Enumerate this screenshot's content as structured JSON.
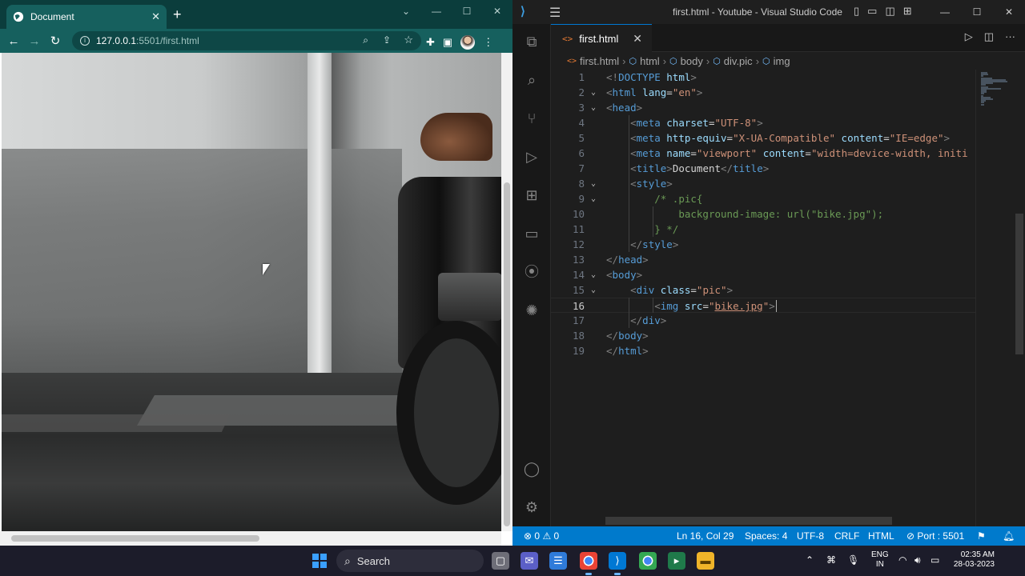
{
  "browser": {
    "tab_title": "Document",
    "url_host": "127.0.0.1",
    "url_rest": ":5501/first.html",
    "image_alt": "bike.jpg",
    "icons": [
      "globe-icon",
      "close-icon",
      "plus-icon",
      "back-icon",
      "forward-icon",
      "reload-icon",
      "info-icon",
      "zoom-icon",
      "share-icon",
      "star-icon",
      "extensions-icon",
      "sidepanel-icon",
      "profile-avatar",
      "kebab-menu-icon"
    ]
  },
  "vscode": {
    "window_title": "first.html - Youtube - Visual Studio Code",
    "tab_label": "first.html",
    "breadcrumbs": [
      "first.html",
      "html",
      "body",
      "div.pic",
      "img"
    ],
    "lines": [
      {
        "n": "1",
        "segs": [
          [
            "p",
            "<!"
          ],
          [
            "t",
            "DOCTYPE"
          ],
          [
            "w",
            " "
          ],
          [
            "a",
            "html"
          ],
          [
            "p",
            ">"
          ]
        ]
      },
      {
        "n": "2",
        "segs": [
          [
            "p",
            "<"
          ],
          [
            "t",
            "html"
          ],
          [
            "w",
            " "
          ],
          [
            "a",
            "lang"
          ],
          [
            "w",
            "="
          ],
          [
            "s",
            "\"en\""
          ],
          [
            "p",
            ">"
          ]
        ]
      },
      {
        "n": "3",
        "segs": [
          [
            "p",
            "<"
          ],
          [
            "t",
            "head"
          ],
          [
            "p",
            ">"
          ]
        ]
      },
      {
        "n": "4",
        "segs": [
          [
            "w",
            "    "
          ],
          [
            "p",
            "<"
          ],
          [
            "t",
            "meta"
          ],
          [
            "w",
            " "
          ],
          [
            "a",
            "charset"
          ],
          [
            "w",
            "="
          ],
          [
            "s",
            "\"UTF-8\""
          ],
          [
            "p",
            ">"
          ]
        ]
      },
      {
        "n": "5",
        "segs": [
          [
            "w",
            "    "
          ],
          [
            "p",
            "<"
          ],
          [
            "t",
            "meta"
          ],
          [
            "w",
            " "
          ],
          [
            "a",
            "http-equiv"
          ],
          [
            "w",
            "="
          ],
          [
            "s",
            "\"X-UA-Compatible\""
          ],
          [
            "w",
            " "
          ],
          [
            "a",
            "content"
          ],
          [
            "w",
            "="
          ],
          [
            "s",
            "\"IE=edge\""
          ],
          [
            "p",
            ">"
          ]
        ]
      },
      {
        "n": "6",
        "segs": [
          [
            "w",
            "    "
          ],
          [
            "p",
            "<"
          ],
          [
            "t",
            "meta"
          ],
          [
            "w",
            " "
          ],
          [
            "a",
            "name"
          ],
          [
            "w",
            "="
          ],
          [
            "s",
            "\"viewport\""
          ],
          [
            "w",
            " "
          ],
          [
            "a",
            "content"
          ],
          [
            "w",
            "="
          ],
          [
            "s",
            "\"width=device-width, initi"
          ]
        ]
      },
      {
        "n": "7",
        "segs": [
          [
            "w",
            "    "
          ],
          [
            "p",
            "<"
          ],
          [
            "t",
            "title"
          ],
          [
            "p",
            ">"
          ],
          [
            "w",
            "Document"
          ],
          [
            "p",
            "</"
          ],
          [
            "t",
            "title"
          ],
          [
            "p",
            ">"
          ]
        ]
      },
      {
        "n": "8",
        "segs": [
          [
            "w",
            "    "
          ],
          [
            "p",
            "<"
          ],
          [
            "t",
            "style"
          ],
          [
            "p",
            ">"
          ]
        ]
      },
      {
        "n": "9",
        "segs": [
          [
            "w",
            "        "
          ],
          [
            "c",
            "/* .pic{"
          ]
        ]
      },
      {
        "n": "10",
        "segs": [
          [
            "w",
            "            "
          ],
          [
            "c",
            "background-image: url(\"bike.jpg\");"
          ]
        ]
      },
      {
        "n": "11",
        "segs": [
          [
            "w",
            "        "
          ],
          [
            "c",
            "} */"
          ]
        ]
      },
      {
        "n": "12",
        "segs": [
          [
            "w",
            "    "
          ],
          [
            "p",
            "</"
          ],
          [
            "t",
            "style"
          ],
          [
            "p",
            ">"
          ]
        ]
      },
      {
        "n": "13",
        "segs": [
          [
            "p",
            "</"
          ],
          [
            "t",
            "head"
          ],
          [
            "p",
            ">"
          ]
        ]
      },
      {
        "n": "14",
        "segs": [
          [
            "p",
            "<"
          ],
          [
            "t",
            "body"
          ],
          [
            "p",
            ">"
          ]
        ]
      },
      {
        "n": "15",
        "segs": [
          [
            "w",
            "    "
          ],
          [
            "p",
            "<"
          ],
          [
            "t",
            "div"
          ],
          [
            "w",
            " "
          ],
          [
            "a",
            "class"
          ],
          [
            "w",
            "="
          ],
          [
            "s",
            "\"pic\""
          ],
          [
            "p",
            ">"
          ]
        ]
      },
      {
        "n": "16",
        "segs": [
          [
            "w",
            "        "
          ],
          [
            "p",
            "<"
          ],
          [
            "t",
            "img"
          ],
          [
            "w",
            " "
          ],
          [
            "a",
            "src"
          ],
          [
            "w",
            "="
          ],
          [
            "s",
            "\""
          ],
          [
            "s",
            "bike.jpg"
          ],
          [
            "s",
            "\""
          ],
          [
            "p",
            ">"
          ]
        ]
      },
      {
        "n": "17",
        "segs": [
          [
            "w",
            "    "
          ],
          [
            "p",
            "</"
          ],
          [
            "t",
            "div"
          ],
          [
            "p",
            ">"
          ]
        ]
      },
      {
        "n": "18",
        "segs": [
          [
            "p",
            "</"
          ],
          [
            "t",
            "body"
          ],
          [
            "p",
            ">"
          ]
        ]
      },
      {
        "n": "19",
        "segs": [
          [
            "p",
            "</"
          ],
          [
            "t",
            "html"
          ],
          [
            "p",
            ">"
          ]
        ]
      }
    ],
    "folds": [
      "2",
      "3",
      "8",
      "9",
      "14",
      "15"
    ],
    "current_line": "16",
    "status": {
      "errors": "0",
      "warnings": "0",
      "position": "Ln 16, Col 29",
      "spaces": "Spaces: 4",
      "encoding": "UTF-8",
      "eol": "CRLF",
      "language": "HTML",
      "port": "Port : 5501"
    }
  },
  "taskbar": {
    "search_label": "Search",
    "lang_top": "ENG",
    "lang_bottom": "IN",
    "time": "02:35 AM",
    "date": "28-03-2023"
  },
  "colors": {
    "browser_frame": "#16605e",
    "vscode_status": "#007acc",
    "tag": "#569cd6",
    "attr": "#9cdcfe",
    "string": "#ce9178",
    "comment": "#6a9955"
  }
}
